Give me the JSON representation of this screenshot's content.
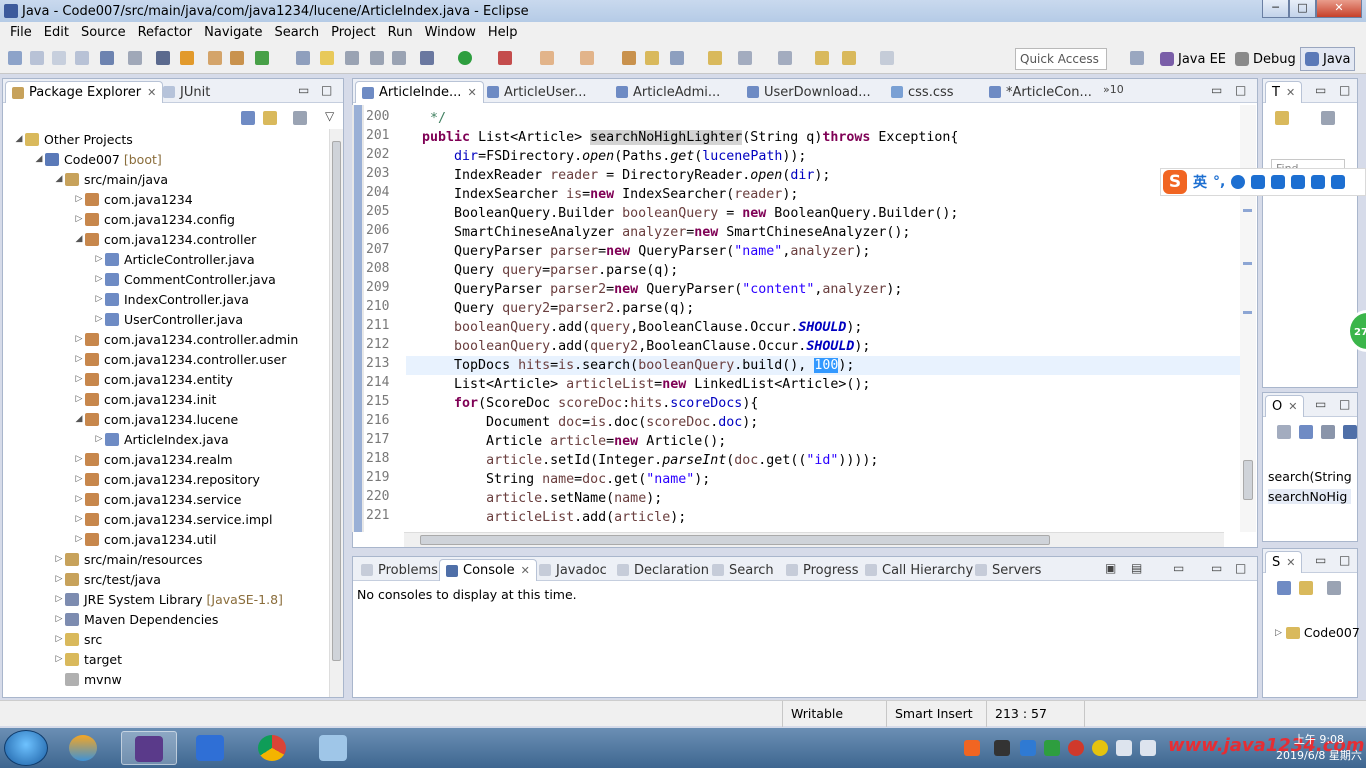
{
  "window": {
    "title": "Java - Code007/src/main/java/com/java1234/lucene/ArticleIndex.java - Eclipse",
    "min_label": "─",
    "max_label": "□",
    "close_label": "✕"
  },
  "menu": [
    "File",
    "Edit",
    "Source",
    "Refactor",
    "Navigate",
    "Search",
    "Project",
    "Run",
    "Window",
    "Help"
  ],
  "toolbar": {
    "quick_access": "Quick Access",
    "perspectives": [
      {
        "label": "Java EE",
        "color": "#7a5ea8"
      },
      {
        "label": "Debug",
        "color": "#8a8a8a"
      },
      {
        "label": "Java",
        "color": "#5a79b8"
      }
    ]
  },
  "package_explorer": {
    "tabs": [
      {
        "label": "Package Explorer",
        "close": "✕"
      },
      {
        "label": "JUnit",
        "close": ""
      }
    ],
    "tree": [
      {
        "arrow": "◢",
        "label": "Other Projects",
        "deco": "",
        "icon_color": "#d9b95c"
      },
      {
        "arrow": "◢",
        "label": "Code007",
        "deco": "[boot]",
        "icon_color": "#5a79b8"
      },
      {
        "arrow": "◢",
        "label": "src/main/java",
        "deco": "",
        "icon_color": "#c7a25b"
      },
      {
        "arrow": "▷",
        "label": "com.java1234",
        "deco": "",
        "icon_color": "#c7874c"
      },
      {
        "arrow": "▷",
        "label": "com.java1234.config",
        "deco": "",
        "icon_color": "#c7874c"
      },
      {
        "arrow": "◢",
        "label": "com.java1234.controller",
        "deco": "",
        "icon_color": "#c7874c"
      },
      {
        "arrow": "▷",
        "label": "ArticleController.java",
        "deco": "",
        "icon_color": "#6e8bc4"
      },
      {
        "arrow": "▷",
        "label": "CommentController.java",
        "deco": "",
        "icon_color": "#6e8bc4"
      },
      {
        "arrow": "▷",
        "label": "IndexController.java",
        "deco": "",
        "icon_color": "#6e8bc4"
      },
      {
        "arrow": "▷",
        "label": "UserController.java",
        "deco": "",
        "icon_color": "#6e8bc4"
      },
      {
        "arrow": "▷",
        "label": "com.java1234.controller.admin",
        "deco": "",
        "icon_color": "#c7874c"
      },
      {
        "arrow": "▷",
        "label": "com.java1234.controller.user",
        "deco": "",
        "icon_color": "#c7874c"
      },
      {
        "arrow": "▷",
        "label": "com.java1234.entity",
        "deco": "",
        "icon_color": "#c7874c"
      },
      {
        "arrow": "▷",
        "label": "com.java1234.init",
        "deco": "",
        "icon_color": "#c7874c"
      },
      {
        "arrow": "◢",
        "label": "com.java1234.lucene",
        "deco": "",
        "icon_color": "#c7874c"
      },
      {
        "arrow": "▷",
        "label": "ArticleIndex.java",
        "deco": "",
        "icon_color": "#6e8bc4"
      },
      {
        "arrow": "▷",
        "label": "com.java1234.realm",
        "deco": "",
        "icon_color": "#c7874c"
      },
      {
        "arrow": "▷",
        "label": "com.java1234.repository",
        "deco": "",
        "icon_color": "#c7874c"
      },
      {
        "arrow": "▷",
        "label": "com.java1234.service",
        "deco": "",
        "icon_color": "#c7874c"
      },
      {
        "arrow": "▷",
        "label": "com.java1234.service.impl",
        "deco": "",
        "icon_color": "#c7874c"
      },
      {
        "arrow": "▷",
        "label": "com.java1234.util",
        "deco": "",
        "icon_color": "#c7874c"
      },
      {
        "arrow": "▷",
        "label": "src/main/resources",
        "deco": "",
        "icon_color": "#c7a25b"
      },
      {
        "arrow": "▷",
        "label": "src/test/java",
        "deco": "",
        "icon_color": "#c7a25b"
      },
      {
        "arrow": "▷",
        "label": "JRE System Library",
        "deco": "[JavaSE-1.8]",
        "icon_color": "#7d8cb0"
      },
      {
        "arrow": "▷",
        "label": "Maven Dependencies",
        "deco": "",
        "icon_color": "#7d8cb0"
      },
      {
        "arrow": "▷",
        "label": "src",
        "deco": "",
        "icon_color": "#d9b95c"
      },
      {
        "arrow": "▷",
        "label": "target",
        "deco": "",
        "icon_color": "#d9b95c"
      },
      {
        "arrow": "",
        "label": "mvnw",
        "deco": "",
        "icon_color": "#b0b0b0"
      }
    ]
  },
  "editor": {
    "tabs": [
      {
        "label": "ArticleInde...",
        "close": "✕"
      },
      {
        "label": "ArticleUser...",
        "close": ""
      },
      {
        "label": "ArticleAdmi...",
        "close": ""
      },
      {
        "label": "UserDownload...",
        "close": ""
      },
      {
        "label": "css.css",
        "close": ""
      },
      {
        "label": "*ArticleCon...",
        "close": ""
      }
    ],
    "overflow": "»10",
    "line_numbers": [
      "200",
      "201",
      "202",
      "203",
      "204",
      "205",
      "206",
      "207",
      "208",
      "209",
      "210",
      "211",
      "212",
      "213",
      "214",
      "215",
      "216",
      "217",
      "218",
      "219",
      "220",
      "221"
    ]
  },
  "bottom_panel": {
    "tabs": [
      "Problems",
      "Console",
      "Javadoc",
      "Declaration",
      "Search",
      "Progress",
      "Call Hierarchy",
      "Servers"
    ],
    "message": "No consoles to display at this time."
  },
  "side_views": {
    "top_label": "T",
    "find_placeholder": "Find",
    "outline_label": "O",
    "outline_items": [
      "search(String",
      "searchNoHig"
    ],
    "servers_label": "S",
    "servers_item": "Code007"
  },
  "ime": {
    "mode": "英",
    "punct": "°,"
  },
  "status": {
    "writable": "Writable",
    "insert_mode": "Smart Insert",
    "position": "213 : 57"
  },
  "taskbar": {
    "time": "上午 9:08",
    "date": "2019/6/8 星期六",
    "watermark": "www.java1234.com",
    "badge": "27"
  }
}
